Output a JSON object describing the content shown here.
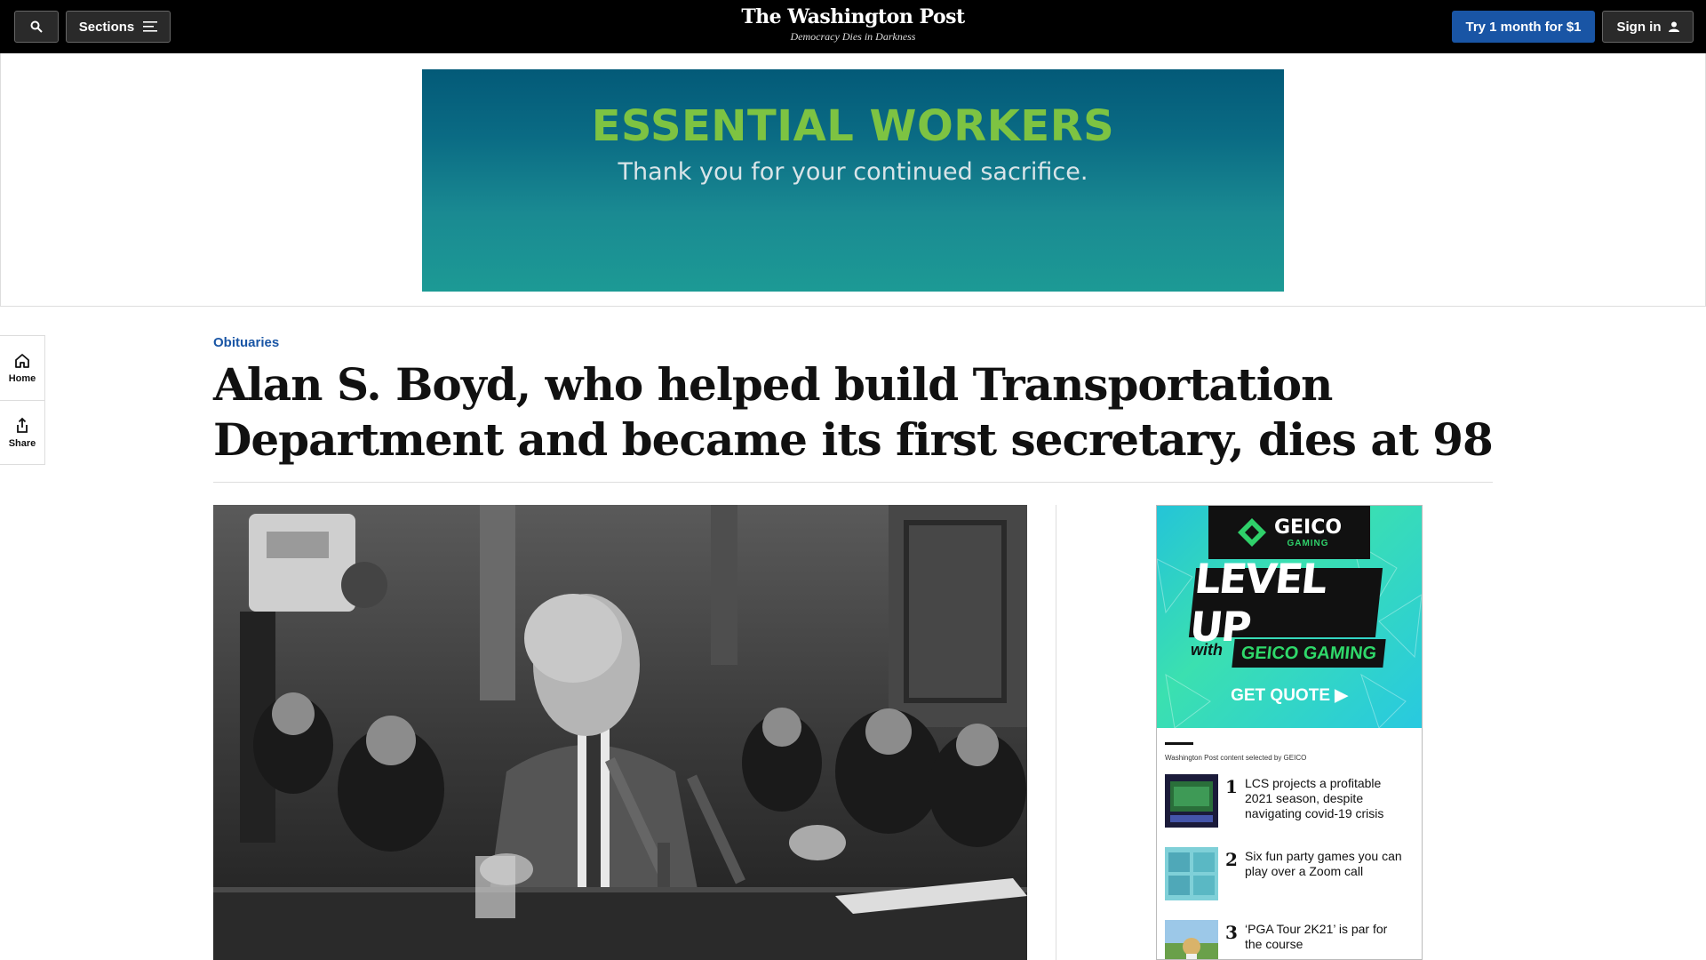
{
  "header": {
    "sections_label": "Sections",
    "logo": "The Washington Post",
    "tagline": "Democracy Dies in Darkness",
    "subscribe_label": "Try 1 month for $1",
    "signin_label": "Sign in"
  },
  "ad_banner": {
    "title": "ESSENTIAL WORKERS",
    "subtitle": "Thank you for your continued sacrifice.",
    "colors": {
      "title": "#7dc342",
      "background": "#0a6b84"
    }
  },
  "rail": {
    "home_label": "Home",
    "share_label": "Share"
  },
  "article": {
    "kicker": "Obituaries",
    "headline": "Alan S. Boyd, who helped build Transportation Department and became its first secretary, dies at 98"
  },
  "sponsor": {
    "ad": {
      "brand": "GEICO",
      "brand_sub": "GAMING",
      "headline": "LEVEL UP",
      "with": "with",
      "product": "GEICO GAMING",
      "cta": "GET QUOTE ▶"
    },
    "note": "Washington Post content selected by GEICO",
    "items": [
      {
        "num": "1",
        "text": "LCS projects a profitable 2021 season, despite navigating covid-19 crisis"
      },
      {
        "num": "2",
        "text": "Six fun party games you can play over a Zoom call"
      },
      {
        "num": "3",
        "text": "‘PGA Tour 2K21’ is par for the course"
      }
    ]
  },
  "colors": {
    "accent": "#1955a5",
    "topbar": "#000000"
  }
}
